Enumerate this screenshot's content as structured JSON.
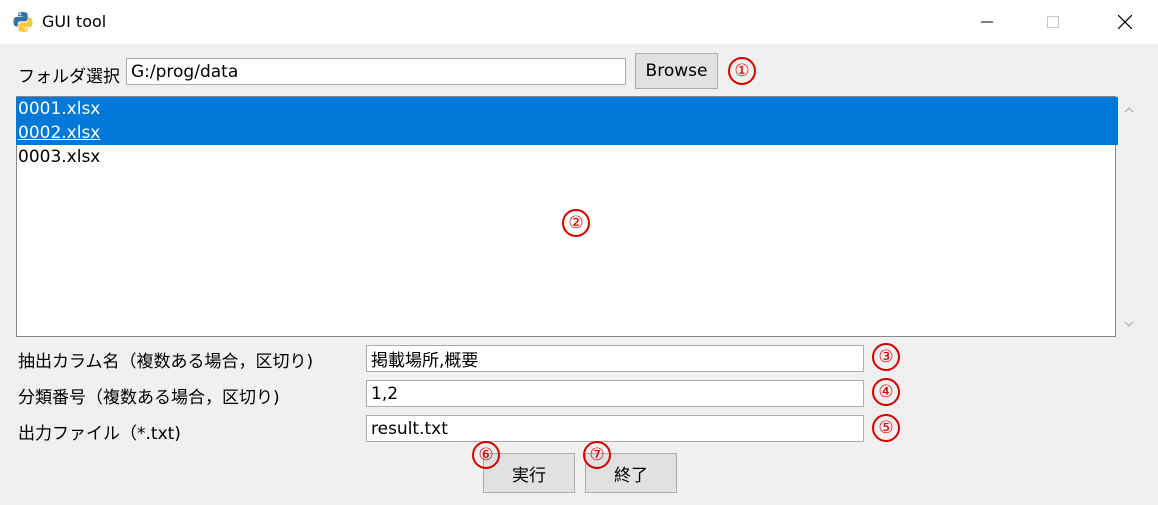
{
  "window": {
    "title": "GUI tool"
  },
  "folder": {
    "label": "フォルダ選択",
    "value": "G:/prog/data",
    "browse_label": "Browse"
  },
  "files": [
    {
      "name": "0001.xlsx",
      "selected": true
    },
    {
      "name": "0002.xlsx",
      "selected": true
    },
    {
      "name": "0003.xlsx",
      "selected": false
    }
  ],
  "form": {
    "column_label": "抽出カラム名（複数ある場合，区切り)",
    "column_value": "掲載場所,概要",
    "category_label": "分類番号（複数ある場合，区切り)",
    "category_value": "1,2",
    "output_label": "出力ファイル（*.txt)",
    "output_value": "result.txt"
  },
  "buttons": {
    "run_label": "実行",
    "exit_label": "終了"
  },
  "annotations": [
    "①",
    "②",
    "③",
    "④",
    "⑤",
    "⑥",
    "⑦"
  ],
  "colors": {
    "selection": "#0078d7",
    "annotation": "#d40000"
  }
}
